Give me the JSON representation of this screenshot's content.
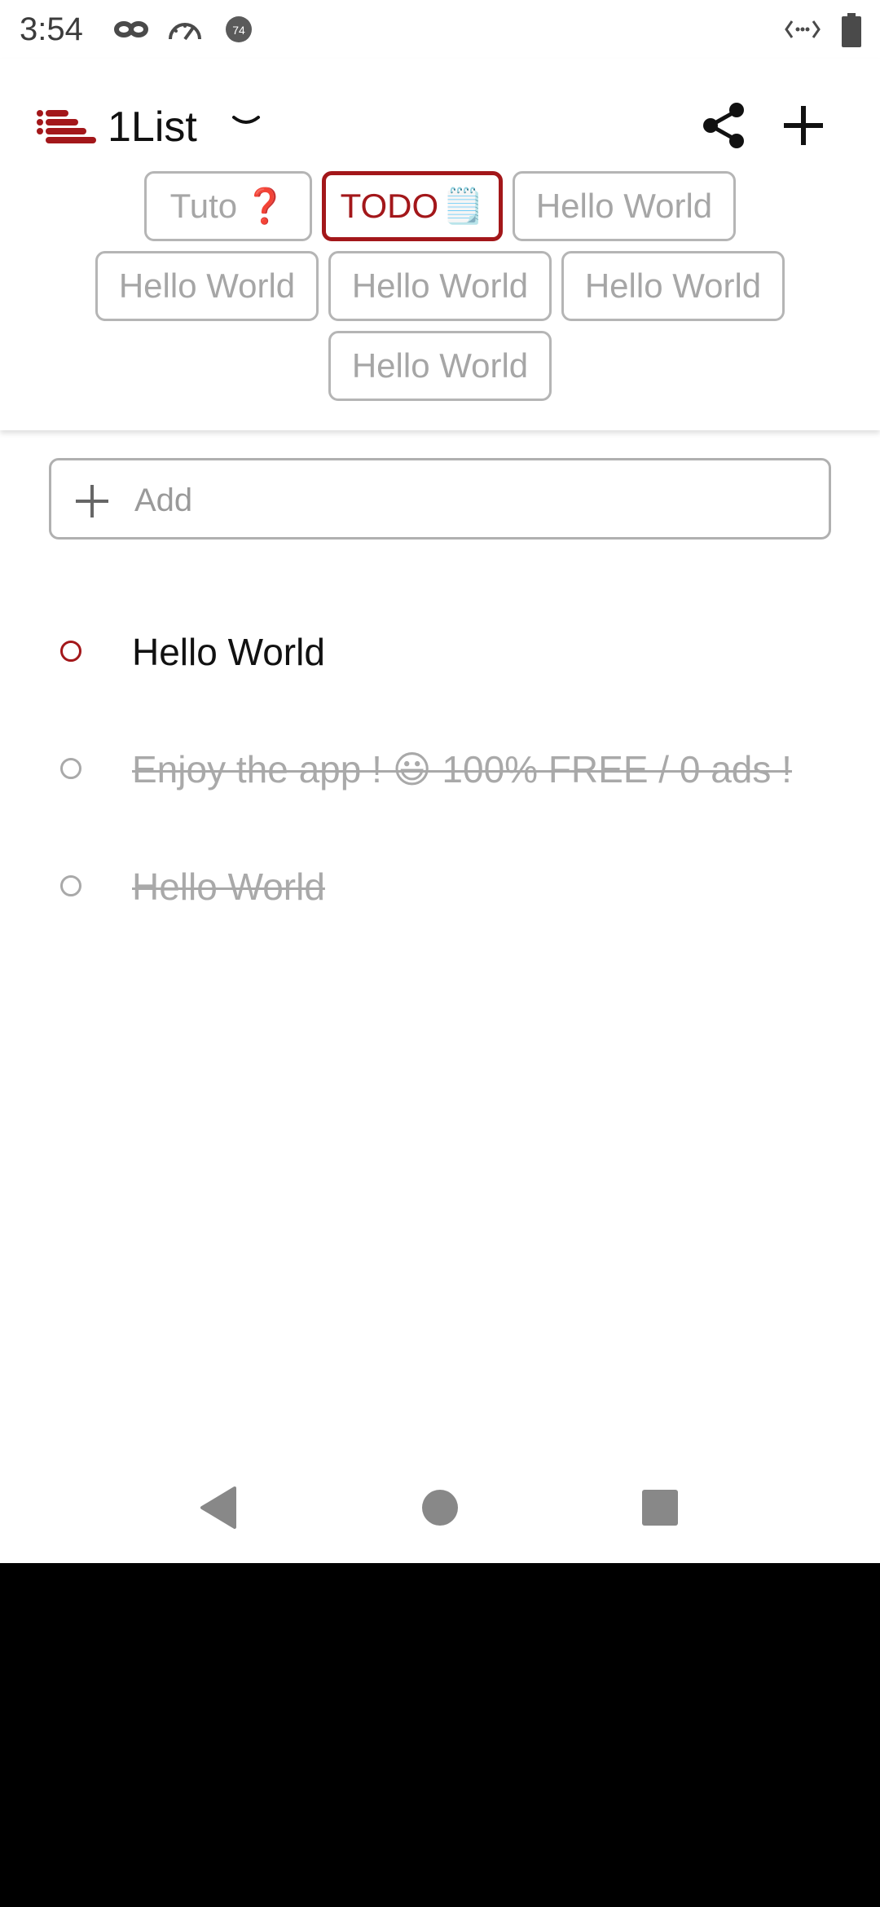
{
  "status_bar": {
    "time": "3:54"
  },
  "header": {
    "app_title": "1List",
    "icons": {
      "logo": "list-logo-icon",
      "chevron": "chevron-down-icon",
      "share": "share-icon",
      "add": "plus-icon"
    }
  },
  "tabs": [
    {
      "label": "Tuto",
      "emoji": "❓",
      "active": false
    },
    {
      "label": "TODO",
      "emoji": "🗒️",
      "active": true
    },
    {
      "label": "Hello World",
      "emoji": "",
      "active": false
    },
    {
      "label": "Hello World",
      "emoji": "",
      "active": false
    },
    {
      "label": "Hello World",
      "emoji": "",
      "active": false
    },
    {
      "label": "Hello World",
      "emoji": "",
      "active": false
    },
    {
      "label": "Hello World",
      "emoji": "",
      "active": false
    }
  ],
  "add_field": {
    "placeholder": "Add",
    "value": ""
  },
  "items": [
    {
      "text": "Hello World",
      "done": false
    },
    {
      "text": "Enjoy the app ! 😃 100% FREE / 0 ads !",
      "done": true
    },
    {
      "text": "Hello World",
      "done": true
    }
  ],
  "colors": {
    "accent": "#a3171a",
    "inactive": "#a6a6a6",
    "text": "#111111"
  }
}
